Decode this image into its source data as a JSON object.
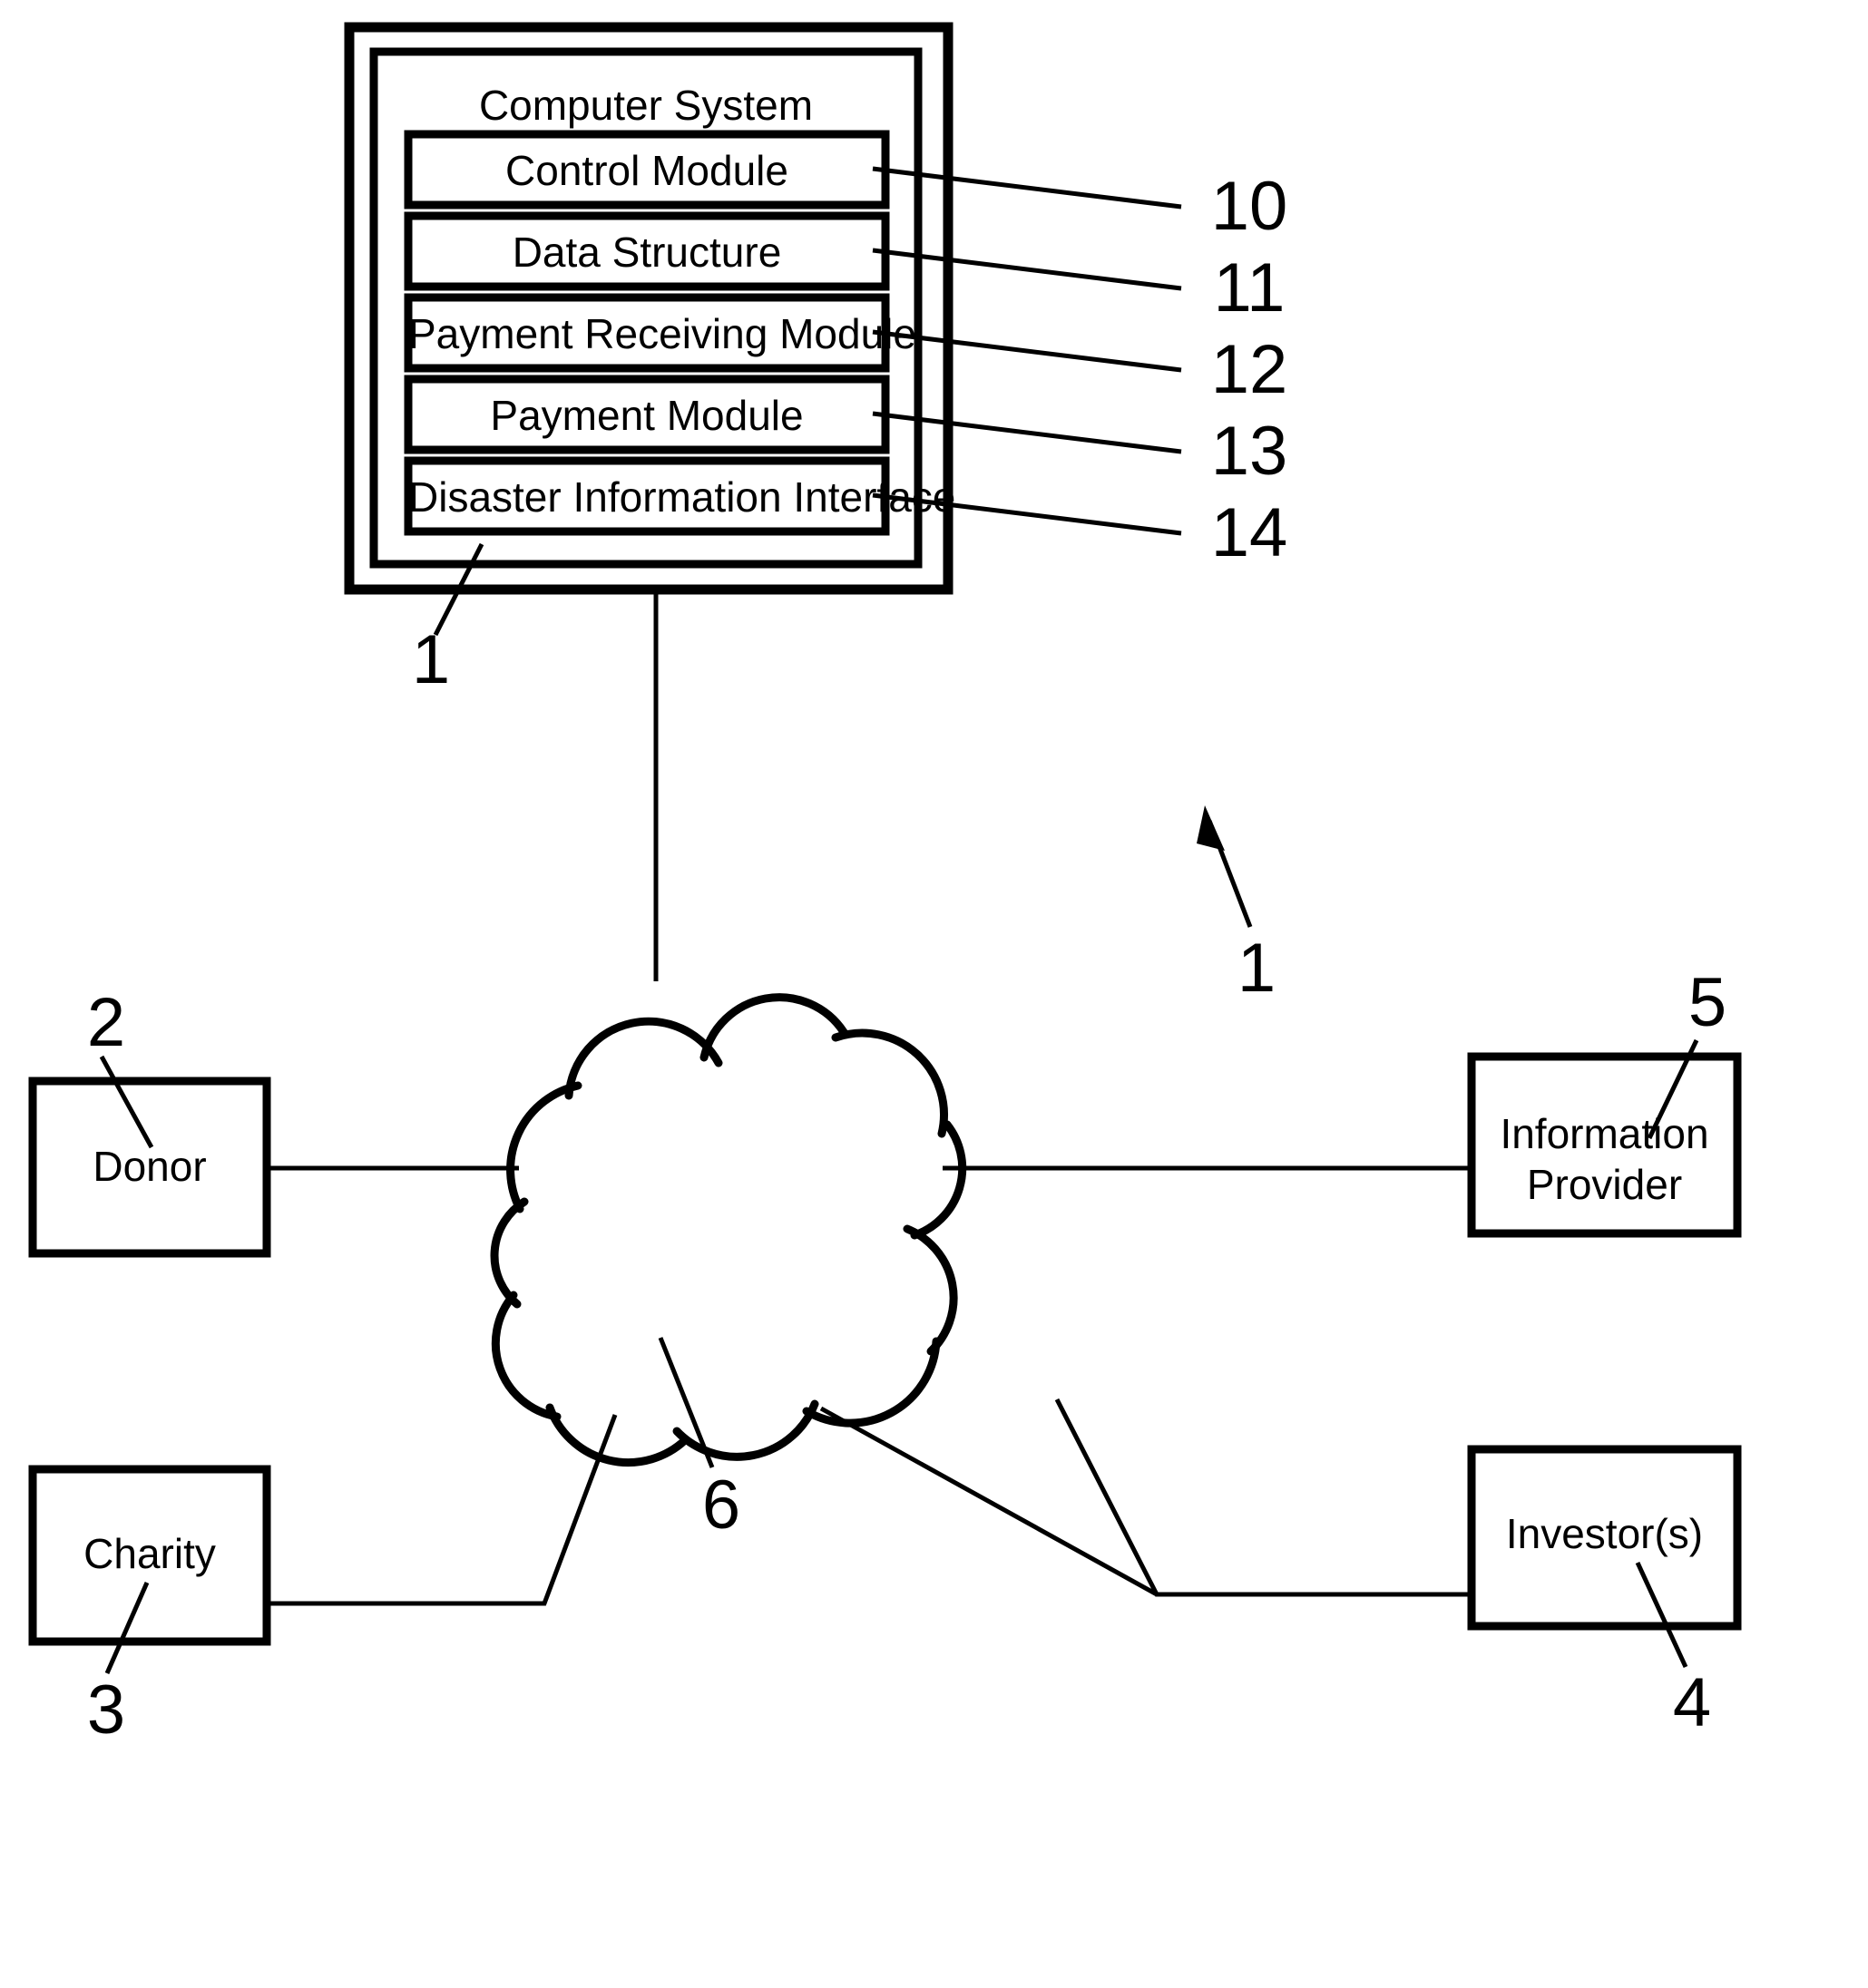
{
  "figure": {
    "type": "patent-block-diagram",
    "background_color": "#ffffff",
    "line_color": "#000000"
  },
  "computer_system": {
    "title": "Computer System",
    "outer_ref": "1",
    "inner_ref": "1",
    "modules": [
      {
        "label": "Control Module",
        "ref": "10"
      },
      {
        "label": "Data Structure",
        "ref": "11"
      },
      {
        "label": "Payment Receiving Module",
        "ref": "12"
      },
      {
        "label": "Payment Module",
        "ref": "13"
      },
      {
        "label": "Disaster Information Interface",
        "ref": "14"
      }
    ]
  },
  "network": {
    "label": "",
    "ref": "6",
    "shape": "cloud"
  },
  "entities": [
    {
      "label": "Donor",
      "ref": "2",
      "position": "top-left"
    },
    {
      "label": "Charity",
      "ref": "3",
      "position": "bottom-left"
    },
    {
      "label_line1": "Information",
      "label_line2": "Provider",
      "ref": "5",
      "position": "top-right"
    },
    {
      "label": "Investor(s)",
      "ref": "4",
      "position": "bottom-right"
    }
  ],
  "ref_numbers": {
    "n1_left": "1",
    "n1_right": "1",
    "n2": "2",
    "n3": "3",
    "n4": "4",
    "n5": "5",
    "n6": "6",
    "n10": "10",
    "n11": "11",
    "n12": "12",
    "n13": "13",
    "n14": "14"
  }
}
